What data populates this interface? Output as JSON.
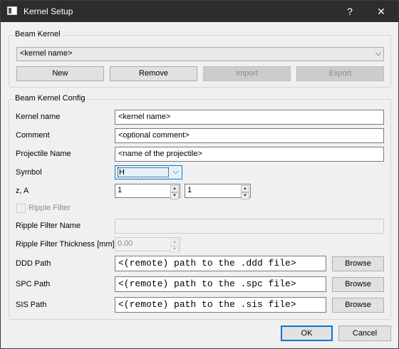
{
  "window": {
    "title": "Kernel Setup",
    "help": "?",
    "close": "✕"
  },
  "beam_kernel": {
    "title": "Beam Kernel",
    "selected": "<kernel name>",
    "buttons": {
      "new": "New",
      "remove": "Remove",
      "import": "Import",
      "export": "Export"
    }
  },
  "config": {
    "title": "Beam Kernel Config",
    "kernel_name": {
      "label": "Kernel name",
      "value": "<kernel name>"
    },
    "comment": {
      "label": "Comment",
      "value": "<optional comment>"
    },
    "projectile": {
      "label": "Projectile Name",
      "value": "<name of the projectile>"
    },
    "symbol": {
      "label": "Symbol",
      "value": "H"
    },
    "za": {
      "label": "z, A",
      "z": "1",
      "a": "1"
    },
    "ripple_filter": {
      "label": "Ripple Filter",
      "checked": false
    },
    "ripple_name": {
      "label": "Ripple Filter Name",
      "value": ""
    },
    "ripple_thickness": {
      "label": "Ripple Filter Thickness [mm]",
      "value": "0.00"
    },
    "ddd": {
      "label": "DDD Path",
      "value": "<(remote) path to the .ddd file>",
      "browse": "Browse"
    },
    "spc": {
      "label": "SPC Path",
      "value": "<(remote) path to the .spc file>",
      "browse": "Browse"
    },
    "sis": {
      "label": "SIS Path",
      "value": "<(remote) path to the .sis file>",
      "browse": "Browse"
    }
  },
  "footer": {
    "ok": "OK",
    "cancel": "Cancel"
  }
}
